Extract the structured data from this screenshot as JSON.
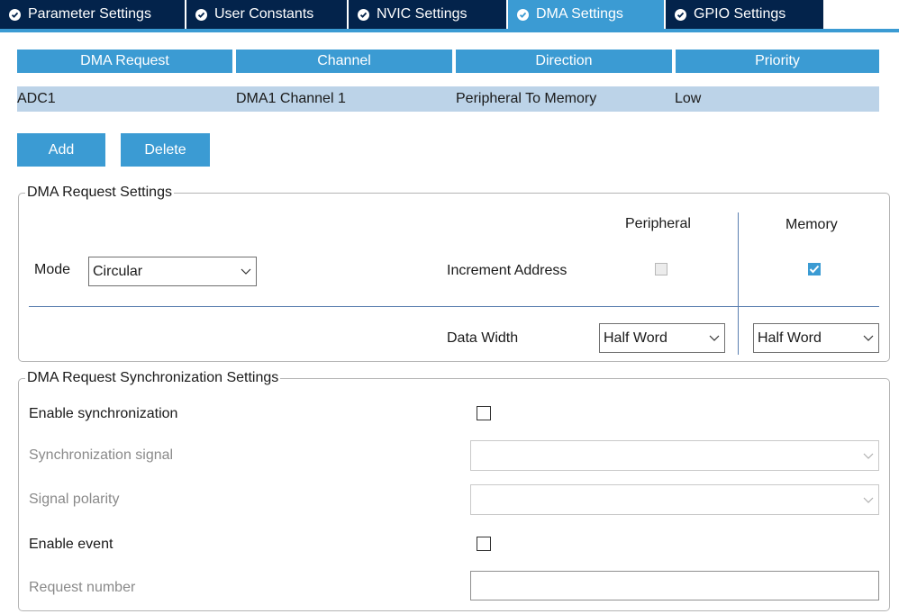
{
  "tabs": [
    {
      "label": "Parameter Settings",
      "active": false
    },
    {
      "label": "User Constants",
      "active": false
    },
    {
      "label": "NVIC Settings",
      "active": false
    },
    {
      "label": "DMA Settings",
      "active": true
    },
    {
      "label": "GPIO Settings",
      "active": false
    }
  ],
  "table": {
    "headers": [
      "DMA Request",
      "Channel",
      "Direction",
      "Priority"
    ],
    "rows": [
      [
        "ADC1",
        "DMA1 Channel 1",
        "Peripheral To Memory",
        "Low"
      ]
    ]
  },
  "buttons": {
    "add": "Add",
    "delete": "Delete"
  },
  "request_settings": {
    "legend": "DMA Request Settings",
    "peripheral_header": "Peripheral",
    "memory_header": "Memory",
    "mode_label": "Mode",
    "mode_value": "Circular",
    "increment_label": "Increment Address",
    "increment_peripheral": false,
    "increment_memory": true,
    "data_width_label": "Data Width",
    "peripheral_width": "Half Word",
    "memory_width": "Half Word"
  },
  "sync_settings": {
    "legend": "DMA Request Synchronization Settings",
    "enable_sync_label": "Enable synchronization",
    "sync_signal_label": "Synchronization signal",
    "signal_polarity_label": "Signal polarity",
    "enable_event_label": "Enable event",
    "request_number_label": "Request number"
  },
  "colors": {
    "tab_bg": "#03234b",
    "accent": "#3b9bd3",
    "row_selected": "#bcd3e8"
  }
}
